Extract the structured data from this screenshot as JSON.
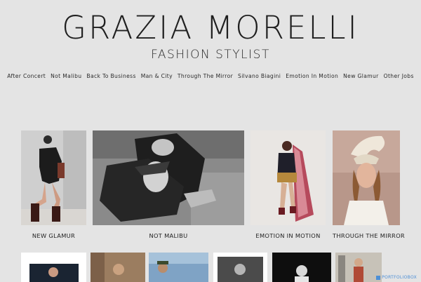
{
  "header": {
    "title": "GRAZIA MORELLI",
    "subtitle": "FASHION STYLIST"
  },
  "nav": {
    "items": [
      "After Concert",
      "Not Malibu",
      "Back To Business",
      "Man & City",
      "Through The Mirror",
      "Silvano Biagini",
      "Emotion In Motion",
      "New Glamur",
      "Other Jobs"
    ]
  },
  "gallery": {
    "row1": [
      {
        "caption": "NEW GLAMUR",
        "photo": "woman-black-jacket-boots-photo"
      },
      {
        "caption": "NOT MALIBU",
        "photo": "couple-lying-bw-photo"
      },
      {
        "caption": "EMOTION IN MOTION",
        "photo": "model-red-fabric-photo"
      },
      {
        "caption": "THROUGH THE MIRROR",
        "photo": "woman-sculptural-hat-photo"
      }
    ]
  },
  "footer": {
    "badge": "PORTFOLIOBOX"
  },
  "colors": {
    "background": "#e4e4e4",
    "text": "#222222",
    "badge": "#4d8fd6"
  }
}
